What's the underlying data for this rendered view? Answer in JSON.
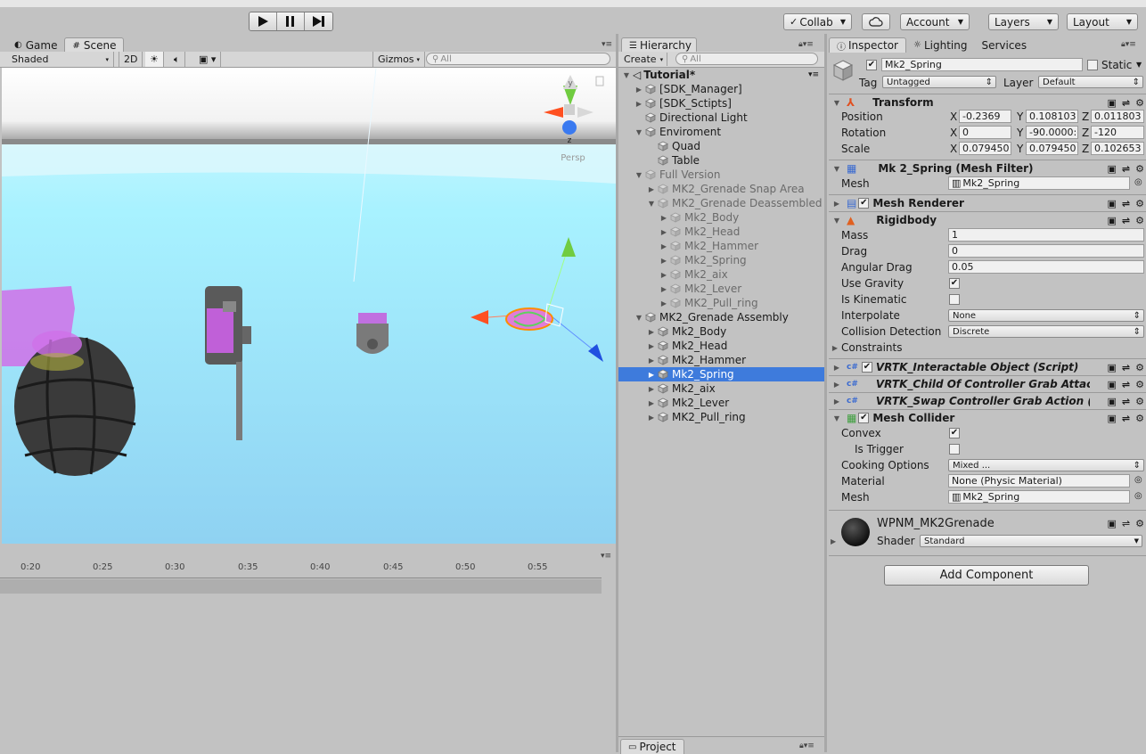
{
  "toolbar": {
    "collab": "Collab",
    "account": "Account",
    "layers": "Layers",
    "layout": "Layout"
  },
  "scene": {
    "tab_game": "Game",
    "tab_scene": "Scene",
    "shading": "Shaded",
    "mode_2d": "2D",
    "gizmos": "Gizmos",
    "search_placeholder": "All",
    "persp": "Persp",
    "axis_y": "y",
    "axis_z": "z"
  },
  "timeline": {
    "ticks": [
      "0:20",
      "0:25",
      "0:30",
      "0:35",
      "0:40",
      "0:45",
      "0:50",
      "0:55"
    ]
  },
  "hierarchy": {
    "tab": "Hierarchy",
    "create": "Create",
    "search_placeholder": "All",
    "scene_name": "Tutorial*",
    "items": [
      {
        "label": "[SDK_Manager]"
      },
      {
        "label": "[SDK_Sctipts]"
      },
      {
        "label": "Directional Light"
      },
      {
        "label": "Enviroment"
      },
      {
        "label": "Quad"
      },
      {
        "label": "Table"
      },
      {
        "label": "Full Version"
      },
      {
        "label": "MK2_Grenade Snap Area"
      },
      {
        "label": "MK2_Grenade Deassembled"
      },
      {
        "label": "Mk2_Body"
      },
      {
        "label": "Mk2_Head"
      },
      {
        "label": "Mk2_Hammer"
      },
      {
        "label": "Mk2_Spring"
      },
      {
        "label": "Mk2_aix"
      },
      {
        "label": "Mk2_Lever"
      },
      {
        "label": "MK2_Pull_ring"
      },
      {
        "label": "MK2_Grenade Assembly"
      },
      {
        "label": "Mk2_Body"
      },
      {
        "label": "Mk2_Head"
      },
      {
        "label": "Mk2_Hammer"
      },
      {
        "label": "Mk2_Spring"
      },
      {
        "label": "Mk2_aix"
      },
      {
        "label": "Mk2_Lever"
      },
      {
        "label": "MK2_Pull_ring"
      }
    ],
    "project_tab": "Project"
  },
  "inspector": {
    "tab_inspector": "Inspector",
    "tab_lighting": "Lighting",
    "tab_services": "Services",
    "object_name": "Mk2_Spring",
    "static_label": "Static",
    "tag_label": "Tag",
    "tag_value": "Untagged",
    "layer_label": "Layer",
    "layer_value": "Default",
    "transform": {
      "title": "Transform",
      "position_label": "Position",
      "rotation_label": "Rotation",
      "scale_label": "Scale",
      "x": "X",
      "y": "Y",
      "z": "Z",
      "position": [
        "-0.2369",
        "0.108103",
        "0.011803"
      ],
      "rotation": [
        "0",
        "-90.0000:",
        "-120"
      ],
      "scale": [
        "0.079450",
        "0.079450",
        "0.102653"
      ]
    },
    "mesh_filter": {
      "title": "Mk 2_Spring (Mesh Filter)",
      "mesh_label": "Mesh",
      "mesh_value": "Mk2_Spring"
    },
    "mesh_renderer": {
      "title": "Mesh Renderer"
    },
    "rigidbody": {
      "title": "Rigidbody",
      "mass_label": "Mass",
      "mass": "1",
      "drag_label": "Drag",
      "drag": "0",
      "angular_drag_label": "Angular Drag",
      "angular_drag": "0.05",
      "use_gravity_label": "Use Gravity",
      "is_kinematic_label": "Is Kinematic",
      "interpolate_label": "Interpolate",
      "interpolate": "None",
      "collision_label": "Collision Detection",
      "collision": "Discrete",
      "constraints_label": "Constraints"
    },
    "scripts": [
      {
        "title": "VRTK_Interactable Object (Script)"
      },
      {
        "title": "VRTK_Child Of Controller Grab Attacl"
      },
      {
        "title": "VRTK_Swap Controller Grab Action (!"
      }
    ],
    "mesh_collider": {
      "title": "Mesh Collider",
      "convex_label": "Convex",
      "is_trigger_label": "Is Trigger",
      "cooking_label": "Cooking Options",
      "cooking": "Mixed ...",
      "material_label": "Material",
      "material": "None (Physic Material)",
      "mesh_label": "Mesh",
      "mesh": "Mk2_Spring"
    },
    "material_block": {
      "name": "WPNM_MK2Grenade",
      "shader_label": "Shader",
      "shader": "Standard"
    },
    "add_component": "Add Component"
  }
}
